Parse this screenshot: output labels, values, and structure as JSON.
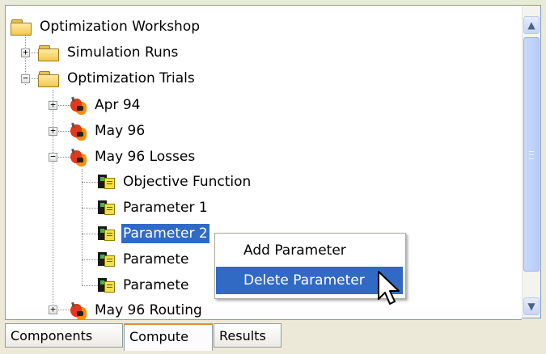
{
  "tree": {
    "root": "Optimization Workshop",
    "simulation_runs": "Simulation Runs",
    "optimization_trials": "Optimization Trials",
    "trials": [
      {
        "label": "Apr 94"
      },
      {
        "label": "May 96"
      },
      {
        "label": "May 96 Losses"
      },
      {
        "label": "May 96 Routing"
      }
    ],
    "children": [
      {
        "label": "Objective Function"
      },
      {
        "label": "Parameter 1"
      },
      {
        "label": "Parameter 2"
      },
      {
        "label": "Paramete"
      },
      {
        "label": "Paramete"
      }
    ]
  },
  "context_menu": {
    "items": [
      {
        "label": "Add Parameter"
      },
      {
        "label": "Delete Parameter"
      }
    ],
    "highlighted_index": 1
  },
  "tabs": [
    {
      "label": "Components"
    },
    {
      "label": "Compute"
    },
    {
      "label": "Results"
    }
  ],
  "active_tab": "Compute",
  "colors": {
    "selection": "#316ac5",
    "active_tab_accent": "#e68b2c",
    "pane_border": "#7f9db9",
    "window_bg": "#ece9d8"
  },
  "icons": {
    "folder": "folder-icon",
    "trial": "optimization-trial-icon",
    "parameter": "parameter-icon",
    "scroll_up": "chevron-up-icon",
    "scroll_down": "chevron-down-icon",
    "cursor": "mouse-pointer-icon"
  },
  "scroll_position": 0.0
}
